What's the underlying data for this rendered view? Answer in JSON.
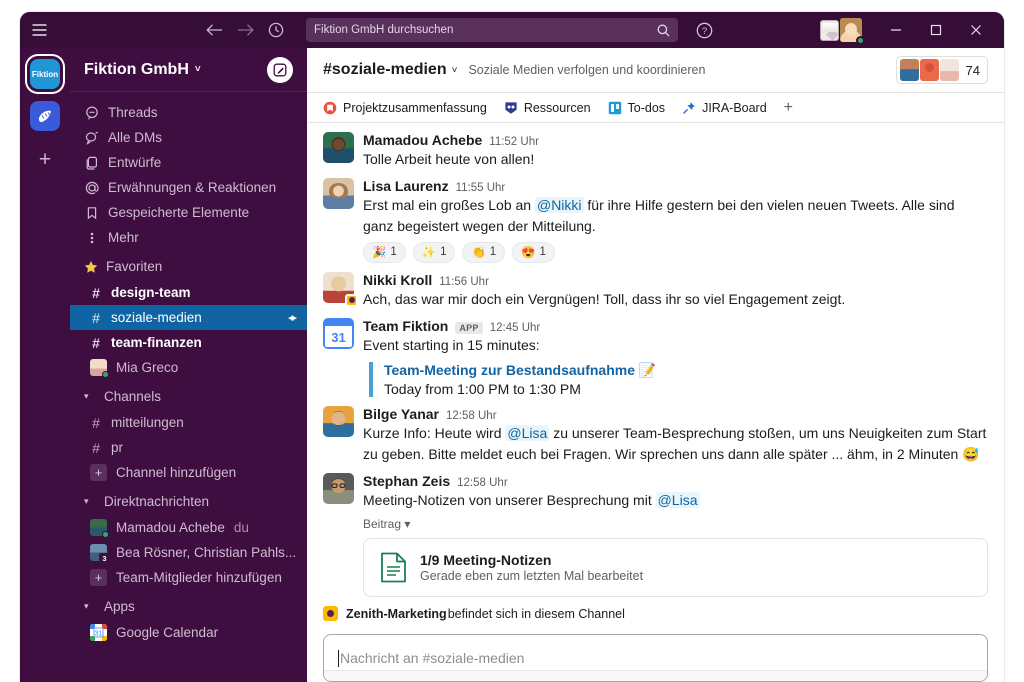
{
  "titlebar": {
    "hamburger_icon": "hamburger-icon",
    "back_icon": "arrow-left-icon",
    "forward_icon": "arrow-right-icon",
    "history_icon": "clock-icon",
    "search_placeholder": "Fiktion GmbH durchsuchen",
    "search_icon": "search-icon",
    "help_icon": "question-circle-icon",
    "minimize_label": "–",
    "maximize_label": "□",
    "close_label": "✕"
  },
  "rail": {
    "workspaces": [
      {
        "name": "Fiktion",
        "label": "Fiktion",
        "color": "#2196d6",
        "active": true
      },
      {
        "name": "croissant-workspace",
        "label": "",
        "color": "#3a5bd9",
        "active": false
      }
    ],
    "add_label": "+"
  },
  "sidebar": {
    "workspace_title": "Fiktion GmbH",
    "caret": "˅",
    "compose_icon": "compose-icon",
    "items": [
      {
        "label": "Threads",
        "icon": "threads-icon"
      },
      {
        "label": "Alle DMs",
        "icon": "dm-icon"
      },
      {
        "label": "Entwürfe",
        "icon": "drafts-icon"
      },
      {
        "label": "Erwähnungen & Reaktionen",
        "icon": "mentions-icon"
      },
      {
        "label": "Gespeicherte Elemente",
        "icon": "bookmark-icon"
      },
      {
        "label": "Mehr",
        "icon": "more-vertical-icon"
      }
    ],
    "favorites": {
      "label": "Favoriten",
      "icon": "star-icon",
      "channels": [
        {
          "label": "design-team",
          "unread": true,
          "selected": false
        },
        {
          "label": "soziale-medien",
          "unread": false,
          "selected": true,
          "badge": "◂▸"
        },
        {
          "label": "team-finanzen",
          "unread": true,
          "selected": false
        }
      ],
      "dm": {
        "label": "Mia Greco",
        "presence": "online"
      }
    },
    "channels_section": {
      "label": "Channels",
      "caret": "▾",
      "items": [
        {
          "label": "mitteilungen",
          "type": "channel"
        },
        {
          "label": "pr",
          "type": "channel"
        },
        {
          "label": "Channel hinzufügen",
          "type": "add"
        }
      ]
    },
    "dm_section": {
      "label": "Direktnachrichten",
      "caret": "▾",
      "items": [
        {
          "label": "Mamadou Achebe",
          "suffix": "du",
          "type": "dm",
          "presence": "online"
        },
        {
          "label": "Bea Rösner, Christian Pahls...",
          "type": "group",
          "count": "3"
        },
        {
          "label": "Team-Mitglieder hinzufügen",
          "type": "add"
        }
      ]
    },
    "apps_section": {
      "label": "Apps",
      "caret": "▾",
      "items": [
        {
          "label": "Google Calendar",
          "type": "app"
        }
      ]
    }
  },
  "channel": {
    "name": "#soziale-medien",
    "caret": "˅",
    "topic": "Soziale Medien verfolgen und koordinieren",
    "member_count": "74",
    "tabs": [
      {
        "label": "Projektzusammenfassung",
        "icon": "bookmark-red-icon",
        "color": "#e8533c"
      },
      {
        "label": "Ressourcen",
        "icon": "shield-icon",
        "color": "#2b3c8f"
      },
      {
        "label": "To-dos",
        "icon": "board-icon",
        "color": "#1a9bdc"
      },
      {
        "label": "JIRA-Board",
        "icon": "pin-icon",
        "color": "#2271c4"
      }
    ],
    "tab_add": "+"
  },
  "messages": [
    {
      "author": "Mamadou Achebe",
      "time": "11:52 Uhr",
      "text": "Tolle Arbeit heute von allen!",
      "avatar_color": "#2e6f4e"
    },
    {
      "author": "Lisa Laurenz",
      "time": "11:55 Uhr",
      "text_parts": [
        {
          "t": "Erst mal ein großes Lob an "
        },
        {
          "t": "@Nikki",
          "mention": true
        },
        {
          "t": " für ihre Hilfe gestern bei den vielen neuen Tweets. Alle sind ganz begeistert wegen der Mitteilung."
        }
      ],
      "avatar_color": "#c79a6b",
      "reactions": [
        {
          "emoji": "🎉",
          "count": "1"
        },
        {
          "emoji": "✨",
          "count": "1"
        },
        {
          "emoji": "👏",
          "count": "1"
        },
        {
          "emoji": "😍",
          "count": "1"
        }
      ]
    },
    {
      "author": "Nikki Kroll",
      "time": "11:56 Uhr",
      "text": "Ach, das war mir doch ein Vergnügen! Toll, dass ihr so viel Engagement zeigt.",
      "avatar_color": "#e8c9a0",
      "status_badge": true
    },
    {
      "author": "Team Fiktion",
      "app_tag": "APP",
      "time": "12:45 Uhr",
      "text": "Event starting in 15 minutes:",
      "avatar_color": "#4285f4",
      "avatar_text": "31",
      "quote": {
        "link": "Team-Meeting zur Bestandsaufnahme 📝",
        "sub": "Today from 1:00 PM to 1:30 PM"
      }
    },
    {
      "author": "Bilge Yanar",
      "time": "12:58 Uhr",
      "text_parts": [
        {
          "t": "Kurze Info: Heute wird "
        },
        {
          "t": "@Lisa",
          "mention": true
        },
        {
          "t": " zu unserer Team-Besprechung stoßen, um uns Neuigkeiten zum Start zu geben. Bitte meldet euch bei Fragen. Wir sprechen uns dann alle später ... ähm, in 2 Minuten 😅"
        }
      ],
      "avatar_color": "#d98c3f"
    },
    {
      "author": "Stephan Zeis",
      "time": "12:58 Uhr",
      "text_parts": [
        {
          "t": "Meeting-Notizen von unserer Besprechung mit "
        },
        {
          "t": "@Lisa",
          "mention": true
        }
      ],
      "avatar_color": "#3b3b3b",
      "beitrag_label": "Beitrag ▾",
      "file": {
        "title": "1/9 Meeting-Notizen",
        "subtitle": "Gerade eben zum letzten Mal bearbeitet",
        "icon": "document-icon"
      }
    }
  ],
  "presence_note": {
    "app_name": "Zenith-Marketing",
    "text": " befindet sich in diesem Channel",
    "icon": "zenith-app-icon"
  },
  "composer": {
    "placeholder": "Nachricht an #soziale-medien"
  },
  "colors": {
    "sidebar_bg": "#3F0E40",
    "titlebar_bg": "#350d36",
    "selected_channel": "#1164A3",
    "link_blue": "#1264a3",
    "mention_bg": "#e8f5fa"
  }
}
